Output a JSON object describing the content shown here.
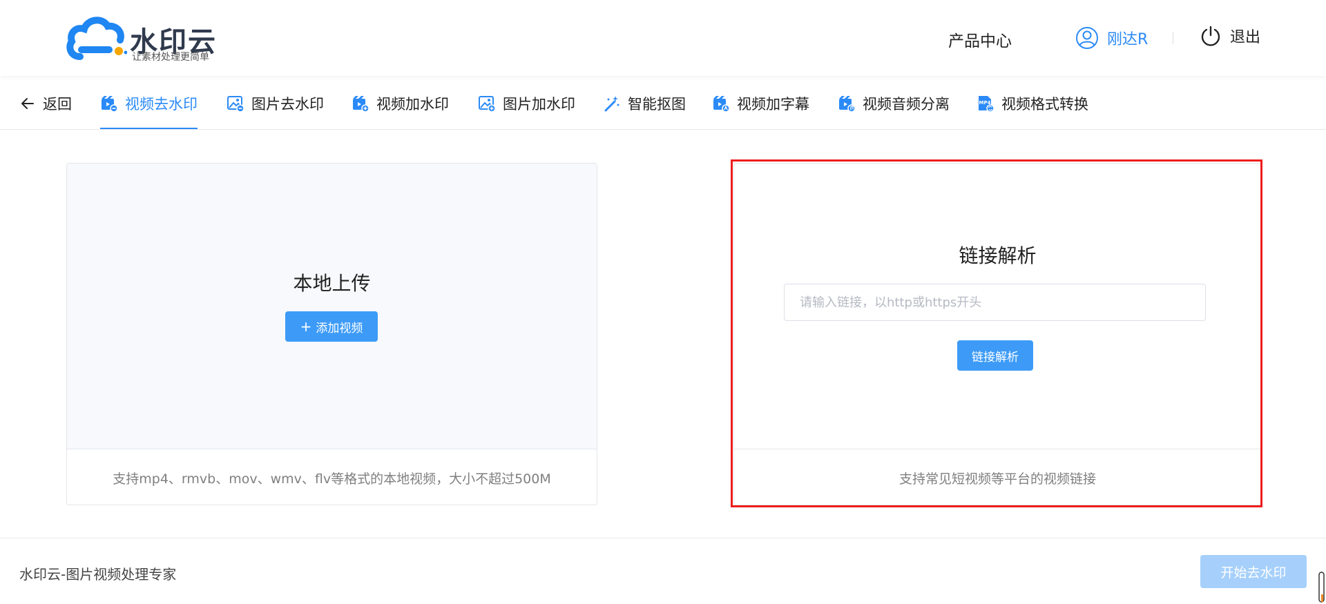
{
  "header": {
    "logo_name": "水印云",
    "logo_slogan": "让素材处理更简单",
    "product_center": "产品中心",
    "user_name": "刚达R",
    "logout_label": "退出"
  },
  "nav": {
    "back_label": "返回",
    "items": [
      {
        "label": "视频去水印",
        "icon": "video-remove-watermark-icon",
        "active": true
      },
      {
        "label": "图片去水印",
        "icon": "image-remove-watermark-icon"
      },
      {
        "label": "视频加水印",
        "icon": "video-add-watermark-icon"
      },
      {
        "label": "图片加水印",
        "icon": "image-add-watermark-icon"
      },
      {
        "label": "智能抠图",
        "icon": "magic-wand-icon"
      },
      {
        "label": "视频加字幕",
        "icon": "video-subtitle-icon"
      },
      {
        "label": "视频音频分离",
        "icon": "audio-separate-icon"
      },
      {
        "label": "视频格式转换",
        "icon": "mp4-convert-icon"
      }
    ]
  },
  "local_upload": {
    "title": "本地上传",
    "button_label": "添加视频",
    "note": "支持mp4、rmvb、mov、wmv、flv等格式的本地视频，大小不超过500M"
  },
  "link_parse": {
    "title": "链接解析",
    "input_value": "",
    "input_placeholder": "请输入链接，以http或https开头",
    "button_label": "链接解析",
    "note": "支持常见短视频等平台的视频链接"
  },
  "footer": {
    "text": "水印云-图片视频处理专家",
    "start_label": "开始去水印"
  },
  "colors": {
    "accent": "#2b8af7",
    "button": "#3d9bf7",
    "button_disabled": "#a6d0fb",
    "highlight_frame": "#ee1c1c"
  }
}
